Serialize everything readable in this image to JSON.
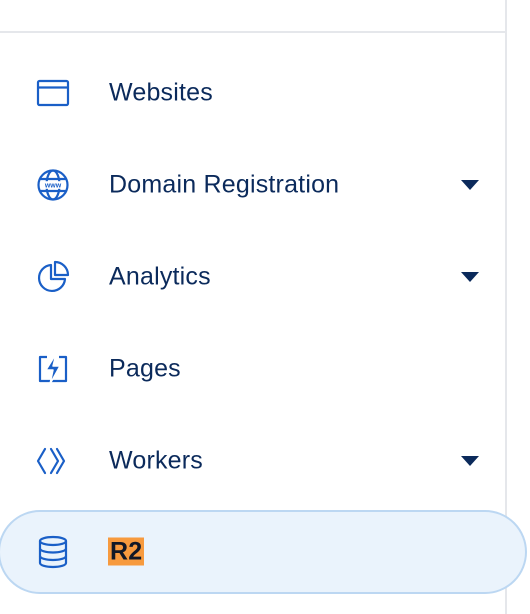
{
  "sidebar": {
    "items": [
      {
        "label": "Websites",
        "icon": "browser-window-icon",
        "has_dropdown": false
      },
      {
        "label": "Domain Registration",
        "icon": "globe-www-icon",
        "has_dropdown": true
      },
      {
        "label": "Analytics",
        "icon": "pie-chart-icon",
        "has_dropdown": true
      },
      {
        "label": "Pages",
        "icon": "lightning-page-icon",
        "has_dropdown": false
      },
      {
        "label": "Workers",
        "icon": "workers-chevrons-icon",
        "has_dropdown": true
      },
      {
        "label": "R2",
        "icon": "database-icon",
        "has_dropdown": false,
        "active": true,
        "highlighted": true
      }
    ],
    "colors": {
      "icon": "#1a5fc7",
      "label": "#0b2a5b",
      "active_background": "#eaf3fc",
      "active_border": "#bcd7f2",
      "highlight": "#f79a3e"
    }
  }
}
